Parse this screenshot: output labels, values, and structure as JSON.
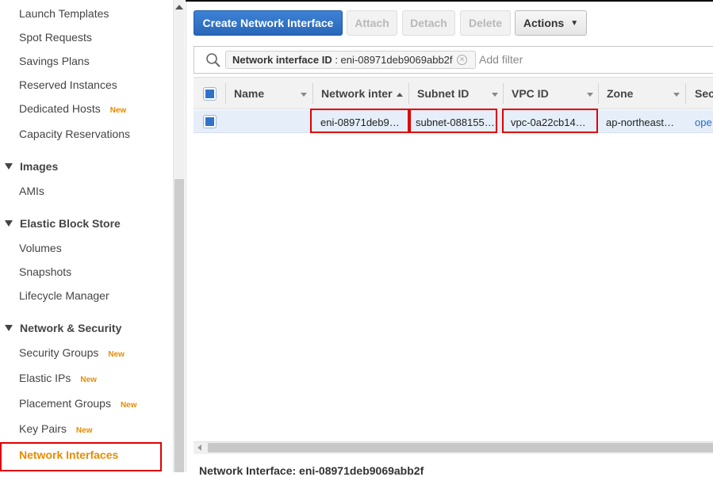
{
  "sidebar": {
    "items": [
      {
        "label": "Launch Templates"
      },
      {
        "label": "Spot Requests"
      },
      {
        "label": "Savings Plans"
      },
      {
        "label": "Reserved Instances"
      },
      {
        "label": "Dedicated Hosts",
        "badge": "New"
      },
      {
        "label": "Capacity Reservations"
      }
    ],
    "images": {
      "title": "Images",
      "items": [
        "AMIs"
      ]
    },
    "ebs": {
      "title": "Elastic Block Store",
      "items": [
        "Volumes",
        "Snapshots",
        "Lifecycle Manager"
      ]
    },
    "netsec": {
      "title": "Network & Security",
      "items": [
        {
          "label": "Security Groups",
          "badge": "New"
        },
        {
          "label": "Elastic IPs",
          "badge": "New"
        },
        {
          "label": "Placement Groups",
          "badge": "New"
        },
        {
          "label": "Key Pairs",
          "badge": "New"
        },
        {
          "label": "Network Interfaces"
        }
      ]
    },
    "badge_color": "#e88b00"
  },
  "toolbar": {
    "create_label": "Create Network Interface",
    "attach_label": "Attach",
    "detach_label": "Detach",
    "delete_label": "Delete",
    "actions_label": "Actions"
  },
  "filter": {
    "token_key": "Network interface ID",
    "token_value": ": eni-08971deb9069abb2f",
    "add_placeholder": "Add filter"
  },
  "table": {
    "columns": [
      "Name",
      "Network interfa",
      "Subnet ID",
      "VPC ID",
      "Zone",
      "Sec"
    ],
    "rows": [
      {
        "name": "",
        "eni": "eni-08971deb9…",
        "subnet": "subnet-088155…",
        "vpc": "vpc-0a22cb14…",
        "zone": "ap-northeast…",
        "sec": "ope"
      }
    ]
  },
  "detail": {
    "title": "Network Interface: eni-08971deb9069abb2f"
  },
  "colors": {
    "accent": "#2f73c9",
    "highlight": "#e00000"
  }
}
